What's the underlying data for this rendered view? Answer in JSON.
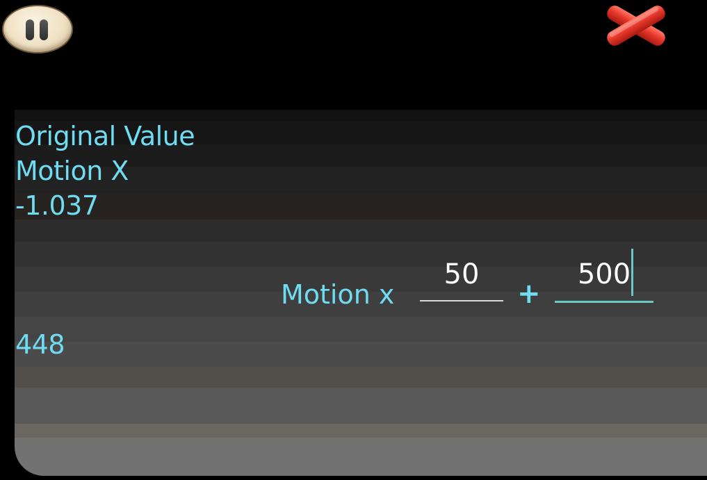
{
  "controls": {
    "pause_icon": "pause-icon",
    "close_icon": "close-x-icon",
    "close_color": "#e8382c"
  },
  "info": {
    "title": "Original Value",
    "sensor": "Motion X",
    "original_value": "-1.037",
    "result_value": "448"
  },
  "formula": {
    "label": "Motion x",
    "multiplier": "50",
    "operator": "+",
    "offset": "500"
  },
  "colors": {
    "text_accent": "#6fdcf2",
    "focus_underline": "#6cc7c9",
    "input_text": "#ffffff"
  }
}
